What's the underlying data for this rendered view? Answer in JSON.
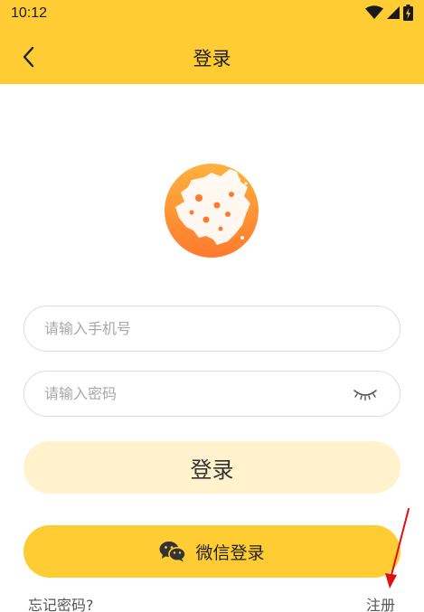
{
  "status_bar": {
    "time": "10:12"
  },
  "nav": {
    "title": "登录"
  },
  "form": {
    "phone_placeholder": "请输入手机号",
    "password_placeholder": "请输入密码"
  },
  "buttons": {
    "login_label": "登录",
    "wechat_label": "微信登录"
  },
  "links": {
    "forgot_password": "忘记密码?",
    "register": "注册"
  },
  "colors": {
    "brand_yellow": "#ffcc33",
    "login_button_bg": "#fff2cc",
    "logo_orange": "#ff8a33",
    "annotation_red": "#e01010"
  }
}
